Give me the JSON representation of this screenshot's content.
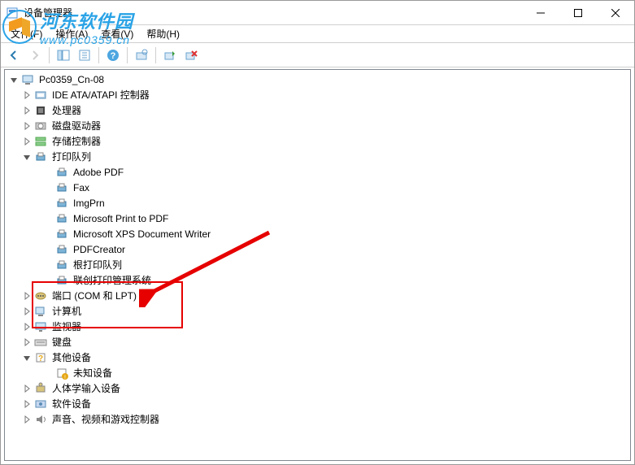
{
  "window": {
    "title": "设备管理器"
  },
  "menu": {
    "file": "文件(F)",
    "action": "操作(A)",
    "view": "查看(V)",
    "help": "帮助(H)"
  },
  "watermark": {
    "cn": "河东软件园",
    "url": "www.pc0359.cn"
  },
  "tree": {
    "root": "Pc0359_Cn-08",
    "items": [
      {
        "label": "IDE ATA/ATAPI 控制器",
        "expanded": false,
        "icon": "ide"
      },
      {
        "label": "处理器",
        "expanded": false,
        "icon": "cpu"
      },
      {
        "label": "磁盘驱动器",
        "expanded": false,
        "icon": "disk"
      },
      {
        "label": "存储控制器",
        "expanded": false,
        "icon": "storage"
      },
      {
        "label": "打印队列",
        "expanded": true,
        "icon": "printer",
        "children": [
          {
            "label": "Adobe PDF"
          },
          {
            "label": "Fax"
          },
          {
            "label": "ImgPrn"
          },
          {
            "label": "Microsoft Print to PDF"
          },
          {
            "label": "Microsoft XPS Document Writer"
          },
          {
            "label": "PDFCreator"
          },
          {
            "label": "根打印队列"
          },
          {
            "label": "联创打印管理系统"
          }
        ]
      },
      {
        "label": "端口 (COM 和 LPT)",
        "expanded": false,
        "icon": "port"
      },
      {
        "label": "计算机",
        "expanded": false,
        "icon": "pc"
      },
      {
        "label": "监视器",
        "expanded": false,
        "icon": "monitor"
      },
      {
        "label": "键盘",
        "expanded": false,
        "icon": "keyboard"
      },
      {
        "label": "其他设备",
        "expanded": true,
        "icon": "other",
        "children": [
          {
            "label": "未知设备",
            "icon": "unknown"
          }
        ]
      },
      {
        "label": "人体学输入设备",
        "expanded": false,
        "icon": "hid"
      },
      {
        "label": "软件设备",
        "expanded": false,
        "icon": "soft"
      },
      {
        "label": "声音、视频和游戏控制器",
        "expanded": false,
        "icon": "sound"
      }
    ]
  }
}
